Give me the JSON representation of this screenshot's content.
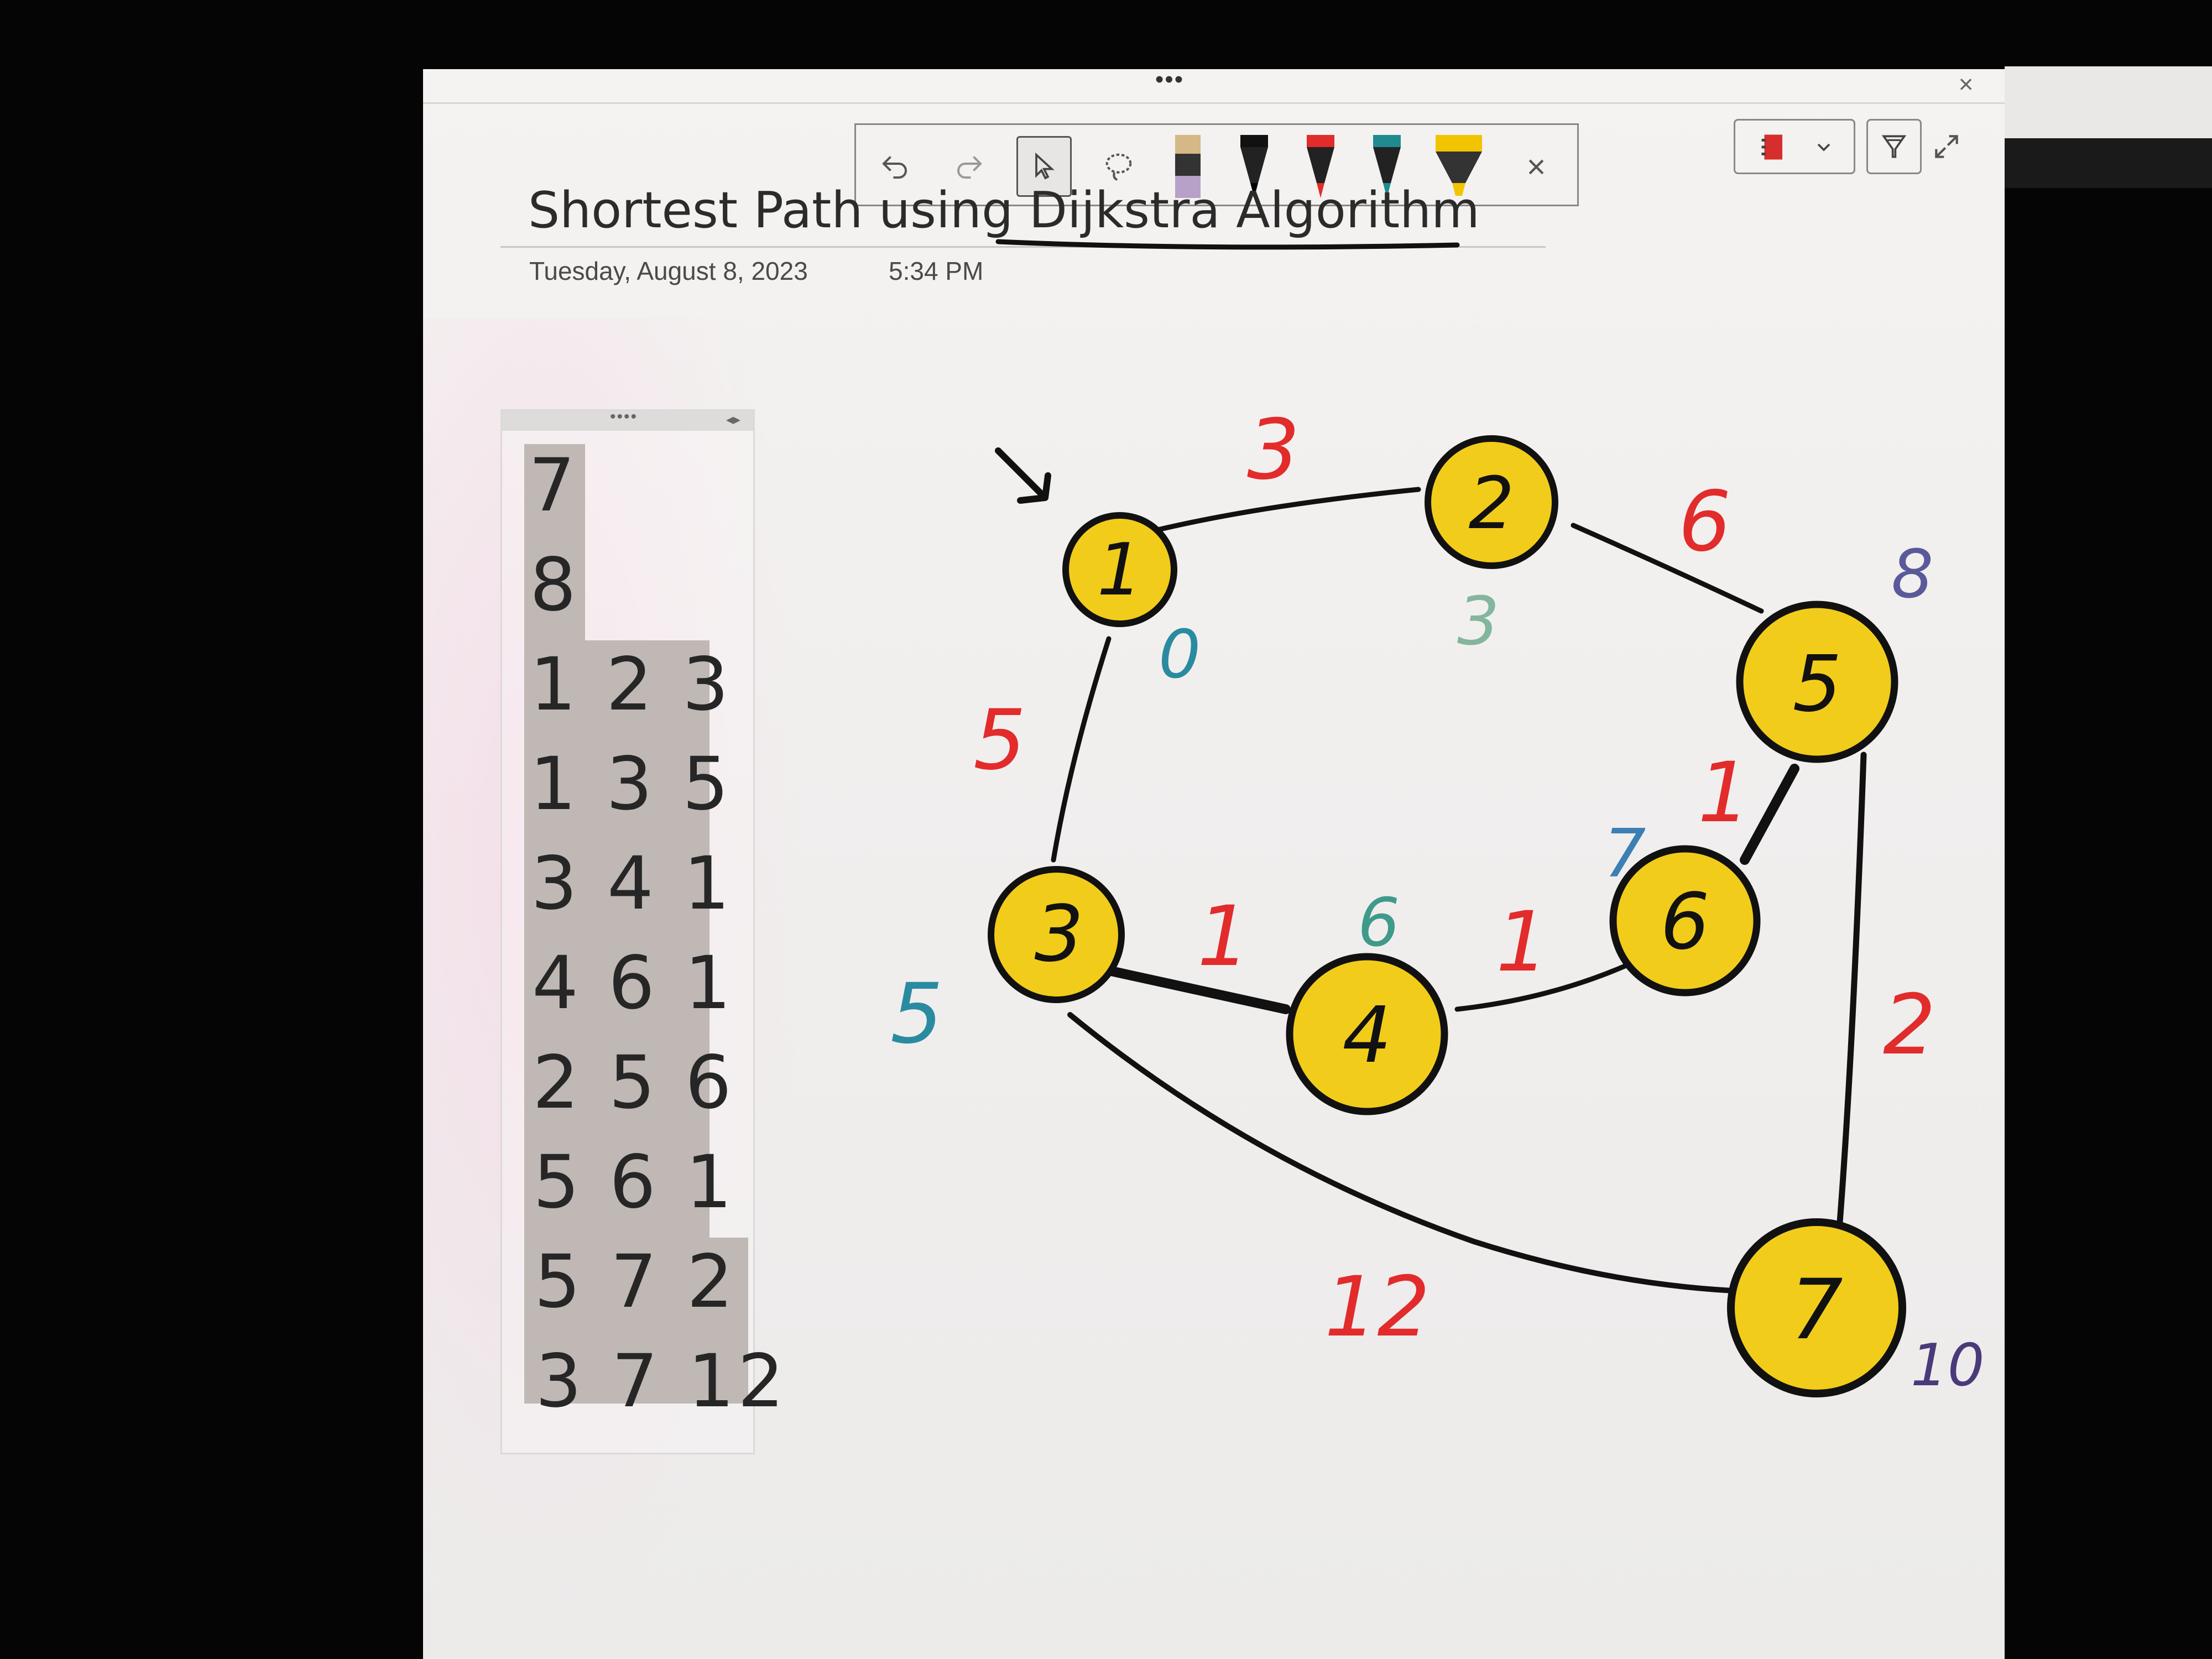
{
  "window": {
    "grip": "•••",
    "close_glyph": "×"
  },
  "ink_toolbar": {
    "undo_icon": "undo-icon",
    "redo_icon": "redo-icon",
    "select_icon": "pointer-icon",
    "lasso_icon": "lasso-icon",
    "pens": [
      {
        "name": "eraser-pen",
        "color": "#c9a97a"
      },
      {
        "name": "black-pen",
        "color": "#111111"
      },
      {
        "name": "red-pen",
        "color": "#e22b2b"
      },
      {
        "name": "teal-pen",
        "color": "#1f8b8f"
      },
      {
        "name": "yellow-highlighter",
        "color": "#f2c400"
      }
    ],
    "close_glyph": "×"
  },
  "page": {
    "title": "Shortest Path using Dijkstra Algorithm",
    "date": "Tuesday, August 8, 2023",
    "time": "5:34 PM"
  },
  "table": {
    "handle_dots": "••••",
    "handle_arrows": "◂▸",
    "rows": [
      "7",
      "8",
      "1 2 3",
      "1 3 5",
      "3 4 1",
      "4 6 1",
      "2 5 6",
      "5 6 1",
      "5 7 2",
      "3 7 12"
    ]
  },
  "graph": {
    "nodes": [
      "1",
      "2",
      "3",
      "4",
      "5",
      "6",
      "7"
    ],
    "edge_weights": [
      "3",
      "6",
      "5",
      "1",
      "1",
      "1",
      "2",
      "12"
    ],
    "distance_labels": [
      "0",
      "3",
      "8",
      "5",
      "6",
      "7",
      "10"
    ],
    "node_fill": "#f2cc1a",
    "weight_color": "#e22b2b",
    "distance_color": "#2a8ba0"
  }
}
